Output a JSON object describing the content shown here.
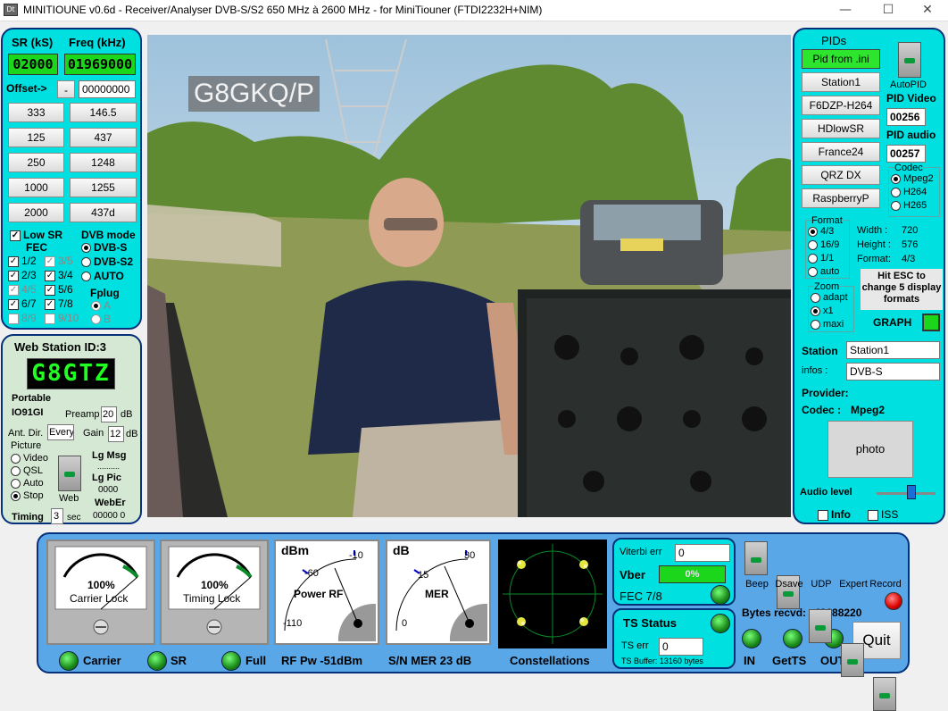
{
  "window": {
    "title": "MINITIOUNE v0.6d - Receiver/Analyser DVB-S/S2 650 MHz à 2600 MHz - for MiniTiouner (FTDI2232H+NIM)",
    "minimize": "—",
    "maximize": "☐",
    "close": "✕"
  },
  "left": {
    "sr_label": "SR (kS)",
    "freq_label": "Freq (kHz)",
    "sr_value": "02000",
    "freq_value": "01969000",
    "offset_label": "Offset->",
    "offset_sign": "-",
    "offset_value": "00000000",
    "sr_buttons": [
      "333",
      "125",
      "250",
      "1000",
      "2000"
    ],
    "freq_buttons": [
      "146.5",
      "437",
      "1248",
      "1255",
      "437d"
    ],
    "low_sr": "Low SR",
    "fec_label": "FEC",
    "dvb_mode_label": "DVB mode",
    "fec": [
      {
        "l": "1/2",
        "c": true,
        "dim": false
      },
      {
        "l": "3/5",
        "c": true,
        "dim": true
      },
      {
        "l": "2/3",
        "c": true,
        "dim": false
      },
      {
        "l": "3/4",
        "c": true,
        "dim": false
      },
      {
        "l": "4/5",
        "c": true,
        "dim": true
      },
      {
        "l": "5/6",
        "c": true,
        "dim": false
      },
      {
        "l": "6/7",
        "c": true,
        "dim": false
      },
      {
        "l": "7/8",
        "c": true,
        "dim": false
      },
      {
        "l": "8/9",
        "c": false,
        "dim": true
      },
      {
        "l": "9/10",
        "c": false,
        "dim": true
      }
    ],
    "dvb_modes": [
      "DVB-S",
      "DVB-S2",
      "AUTO"
    ],
    "fplug_label": "Fplug",
    "fplug": [
      "A",
      "B"
    ]
  },
  "web": {
    "title": "Web Station ID:3",
    "callsign": "G8GTZ",
    "location": "Portable",
    "locator": "IO91GI",
    "preamp_label": "Preamp",
    "preamp_value": "20",
    "preamp_unit": "dB",
    "ant_label": "Ant. Dir.",
    "ant_value": "Every",
    "gain_label": "Gain",
    "gain_value": "12",
    "gain_unit": "dB",
    "picture_label": "Picture",
    "picture_options": [
      "Video",
      "QSL",
      "Auto",
      "Stop"
    ],
    "web_label": "Web",
    "lg_msg": "Lg Msg",
    "dots": "..........",
    "lg_pic": "Lg Pic",
    "lg_pic_val": "0000",
    "weber": "WebEr",
    "weber_val": "00000  0",
    "timing_label": "Timing",
    "timing_value": "3",
    "timing_unit": "sec"
  },
  "video": {
    "overlay": "G8GKQ/P"
  },
  "right": {
    "pids_title": "PIDs",
    "pid_from_ini": "Pid from .ini",
    "buttons": [
      "Station1",
      "F6DZP-H264",
      "HDlowSR",
      "France24",
      "QRZ DX",
      "RaspberryP"
    ],
    "autopid": "AutoPID",
    "pid_video_label": "PID Video",
    "pid_video": "00256",
    "pid_audio_label": "PID audio",
    "pid_audio": "00257",
    "codec_label": "Codec",
    "codecs": [
      "Mpeg2",
      "H264",
      "H265"
    ],
    "format_label": "Format",
    "formats": [
      "4/3",
      "16/9",
      "1/1",
      "auto"
    ],
    "width_label": "Width :",
    "width_val": "720",
    "height_label": "Height :",
    "height_val": "576",
    "format2_label": "Format:",
    "format2_val": "4/3",
    "zoom_label": "Zoom",
    "zooms": [
      "adapt",
      "x1",
      "maxi"
    ],
    "hint": "Hit ESC to change 5 display formats",
    "graph_label": "GRAPH",
    "station_label": "Station",
    "station_val": "Station1",
    "infos_label": "infos :",
    "infos_val": "DVB-S",
    "provider_label": "Provider:",
    "codec2_label": "Codec :",
    "codec2_val": "Mpeg2",
    "photo": "photo",
    "audio_label": "Audio level",
    "audio_level": 0.6,
    "info_cb": "Info",
    "iss_cb": "ISS"
  },
  "bottom": {
    "carrier_pct": "100%",
    "carrier_lock": "Carrier Lock",
    "timing_pct": "100%",
    "timing_lock": "Timing Lock",
    "rf_unit": "dBm",
    "rf_ticks": [
      "-60",
      "-10",
      "-110"
    ],
    "rf_name": "Power RF",
    "mer_unit": "dB",
    "mer_ticks": [
      "15",
      "30",
      "0"
    ],
    "mer_name": "MER",
    "carrier": "Carrier",
    "sr": "SR",
    "full": "Full",
    "rf_pw": "RF Pw -51dBm",
    "sn_mer": "S/N MER  23 dB",
    "constellations": "Constellations",
    "viterbi_label": "Viterbi err",
    "viterbi_val": "0",
    "vber_label": "Vber",
    "vber_val": "0%",
    "fec": "FEC 7/8",
    "ts_status": "TS Status",
    "ts_err_label": "TS err",
    "ts_err_val": "0",
    "ts_buffer": "TS Buffer: 13160 bytes",
    "switches": [
      "Beep",
      "Dsave",
      "UDP",
      "Expert",
      "Record"
    ],
    "bytes_label": "Bytes recvd:",
    "bytes_val": "42688220",
    "in": "IN",
    "getts": "GetTS",
    "out": "OUT",
    "quit": "Quit"
  }
}
